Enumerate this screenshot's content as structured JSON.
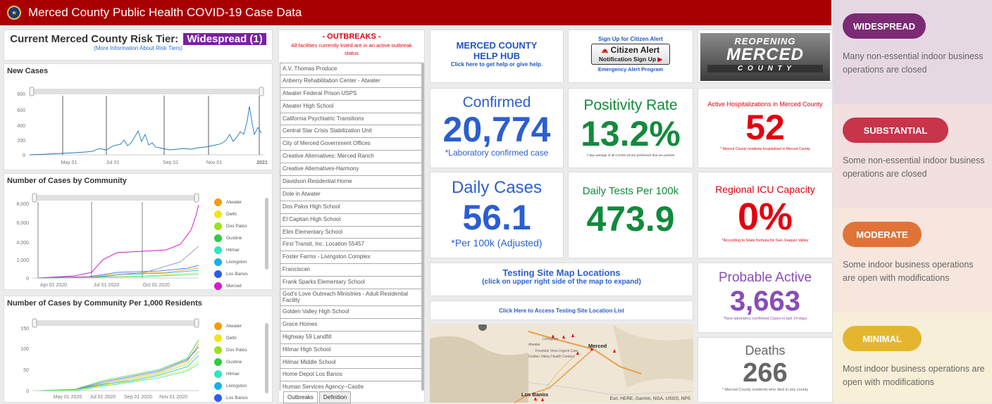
{
  "header": {
    "title": "Merced County Public Health COVID-19 Case Data"
  },
  "risk_tier": {
    "label": "Current Merced County Risk Tier:",
    "value": "Widespread (1)",
    "link": "(More Information About Risk Tiers)"
  },
  "new_cases_chart": {
    "title": "New Cases",
    "y_ticks": [
      "800",
      "600",
      "400",
      "200",
      "0"
    ],
    "x_ticks": [
      "May 01",
      "Jul 01",
      "Sep 01",
      "Nov 01",
      "2021"
    ]
  },
  "community_chart": {
    "title": "Number of Cases by Community",
    "y_ticks": [
      "8,000",
      "6,000",
      "4,000",
      "2,000",
      "0"
    ],
    "x_ticks": [
      "Apr 01 2020",
      "Jul 01 2020",
      "Oct 01 2020"
    ],
    "legend": [
      {
        "name": "Atwater",
        "color": "#f39c12"
      },
      {
        "name": "Delhi",
        "color": "#f1e41a"
      },
      {
        "name": "Dos Palos",
        "color": "#9be21c"
      },
      {
        "name": "Gustine",
        "color": "#2ecc40"
      },
      {
        "name": "Hilmar",
        "color": "#2ee8c0"
      },
      {
        "name": "Livingston",
        "color": "#1ab0e8"
      },
      {
        "name": "Los Banos",
        "color": "#2a5ee8"
      },
      {
        "name": "Merced",
        "color": "#d21ad2"
      }
    ]
  },
  "per1000_chart": {
    "title": "Number of Cases by Community Per 1,000 Residents",
    "y_ticks": [
      "150",
      "100",
      "50",
      "0"
    ],
    "x_ticks": [
      "May 01 2020",
      "Jul 01 2020",
      "Sep 01 2020",
      "Nov 01 2020"
    ],
    "legend": [
      {
        "name": "Atwater",
        "color": "#f39c12"
      },
      {
        "name": "Delhi",
        "color": "#f1e41a"
      },
      {
        "name": "Dos Palos",
        "color": "#9be21c"
      },
      {
        "name": "Gustine",
        "color": "#2ecc40"
      },
      {
        "name": "Hilmar",
        "color": "#2ee8c0"
      },
      {
        "name": "Livingston",
        "color": "#1ab0e8"
      },
      {
        "name": "Los Banos",
        "color": "#2a5ee8"
      }
    ]
  },
  "outbreaks": {
    "title": "- OUTBREAKS -",
    "subtitle": "All facilities currently listed are in an active outbreak status",
    "items": [
      "A.V. Thomas Produce",
      "Anberry Rehabilitation Center - Atwater",
      "Atwater Federal Prison USPS",
      "Atwater High School",
      "California Psychiatric Transitions",
      "Central Star Crisis Stabilization Unit",
      "City of Merced Government Offices",
      "Creative Alternatives: Merced Ranch",
      "Creative Alternatives-Harmony",
      "Davidson Residential Home",
      "Dole in Atwater",
      "Dos Palos High School",
      "El Capitan High School",
      "Elim Elementary School",
      "First Transit, Inc. Location 55457",
      "Foster Farms - Livingston Complex",
      "Franciscan",
      "Frank Sparks Elementary School",
      "God's Love Outreach Ministries - Adult Residential Facility",
      "Golden Valley High School",
      "Grace Homes",
      "Highway 59 Landfill",
      "Hilmar High School",
      "Hilmar Middle School",
      "Home Depot Los Banos",
      "Human Services Agency--Castle"
    ],
    "tabs": [
      "Outbreaks",
      "Definition"
    ]
  },
  "help_hub": {
    "title1": "MERCED COUNTY",
    "title2": "HELP HUB",
    "sub": "Click here to get help or give help."
  },
  "citizen_alert": {
    "top": "Sign Up for Citizen Alert",
    "brand": "Citizen Alert",
    "signup": "Notification Sign Up",
    "bottom": "Emergency Alert Program"
  },
  "reopening": {
    "line1": "REOPENING",
    "line2": "MERCED",
    "line3": "C O U N T Y"
  },
  "confirmed": {
    "title": "Confirmed",
    "value": "20,774",
    "note": "*Laboratory confirmed case"
  },
  "positivity": {
    "title": "Positivity Rate",
    "value": "13.2%",
    "note": "7-day average of all COVID-19 test performed that are positive"
  },
  "hospitalizations": {
    "title": "Active Hospitalizations in Merced County",
    "value": "52",
    "note": "* Merced County residents hospitalized in Merced County"
  },
  "daily_cases": {
    "title": "Daily Cases",
    "value": "56.1",
    "note": "*Per 100k (Adjusted)"
  },
  "daily_tests": {
    "title": "Daily Tests Per 100k",
    "value": "473.9"
  },
  "icu": {
    "title": "Regional ICU Capacity",
    "value": "0%",
    "note": "*According to State formula for San Joaquin Valley"
  },
  "testing_map": {
    "title": "Testing Site Map Locations",
    "sub": "(click on upper right side of the map to expand)",
    "link": "Click Here to Access Testing Site Location List",
    "attribution": "Esri, HERE, Garmin, NGA, USGS, NPS",
    "labels": [
      "Merced",
      "Los Banos",
      "Fountain View Urgent Care",
      "Golden Valley Health Centers",
      "Livingston",
      "Atwater"
    ]
  },
  "probable": {
    "title": "Probable Active",
    "value": "3,663",
    "note": "*New laboratory confirmed Cases in last 14 days"
  },
  "deaths": {
    "title": "Deaths",
    "value": "266",
    "note": "* Merced County residents who died in any county"
  },
  "tiers": [
    {
      "label": "WIDESPREAD",
      "desc": "Many non-essential indoor business operations are closed",
      "color": "#7b2a74",
      "bg": "#e6d8e2"
    },
    {
      "label": "SUBSTANTIAL",
      "desc": "Some non-essential indoor business operations are closed",
      "color": "#c8344a",
      "bg": "#f2dfe0"
    },
    {
      "label": "MODERATE",
      "desc": "Some indoor business operations are open with modifications",
      "color": "#e07438",
      "bg": "#f7e6dd"
    },
    {
      "label": "MINIMAL",
      "desc": "Most indoor business operations are open with modifications",
      "color": "#e4b630",
      "bg": "#f8efd8"
    }
  ]
}
